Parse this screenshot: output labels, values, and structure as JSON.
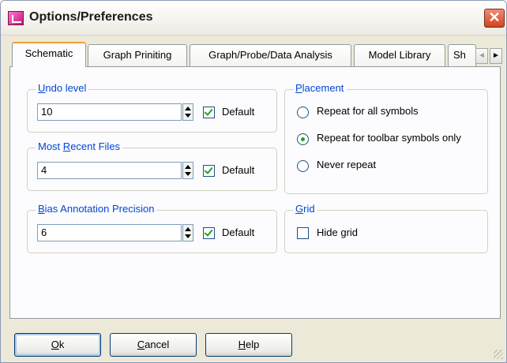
{
  "window": {
    "title": "Options/Preferences",
    "close_glyph": "✕"
  },
  "tabs": [
    {
      "label": "Schematic",
      "active": true
    },
    {
      "label": "Graph Priniting",
      "active": false
    },
    {
      "label": "Graph/Probe/Data Analysis",
      "active": false
    },
    {
      "label": "Model Library",
      "active": false
    },
    {
      "label": "Sh",
      "active": false
    }
  ],
  "tab_scroll": {
    "left": "◄",
    "right": "►"
  },
  "undo": {
    "label_u": "U",
    "label_rest": "ndo level",
    "value": "10",
    "default_label": "Default",
    "default_checked": true
  },
  "recent": {
    "label_pre": "Most ",
    "label_u": "R",
    "label_rest": "ecent Files",
    "value": "4",
    "default_label": "Default",
    "default_checked": true
  },
  "bias": {
    "label_u": "B",
    "label_rest": "ias Annotation Precision",
    "value": "6",
    "default_label": "Default",
    "default_checked": true
  },
  "placement": {
    "label_u": "P",
    "label_rest": "lacement",
    "options": [
      {
        "label": "Repeat for all symbols",
        "selected": false
      },
      {
        "label": "Repeat for toolbar symbols only",
        "selected": true
      },
      {
        "label": "Never repeat",
        "selected": false
      }
    ]
  },
  "grid": {
    "label_u": "G",
    "label_rest": "rid",
    "hide_label": "Hide grid",
    "hide_checked": false
  },
  "buttons": {
    "ok_u": "O",
    "ok_rest": "k",
    "cancel_u": "C",
    "cancel_rest": "ancel",
    "help_u": "H",
    "help_rest": "elp"
  }
}
